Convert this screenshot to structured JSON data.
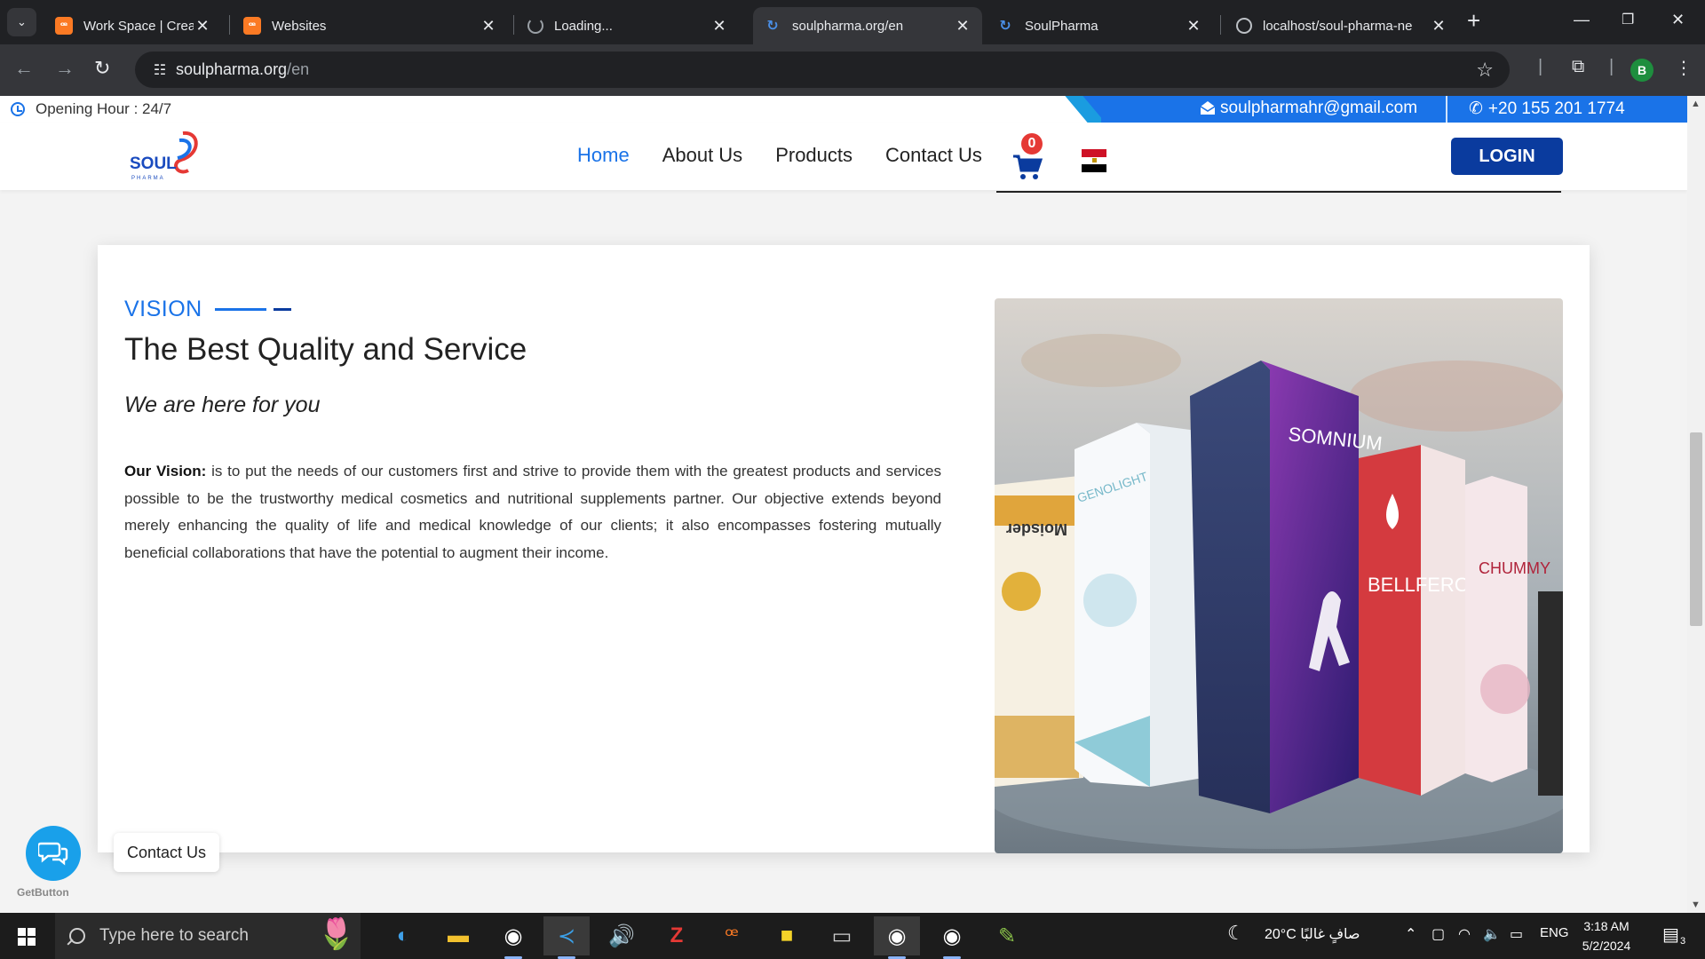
{
  "browser": {
    "tabs": [
      {
        "title": "Work Space | Created By E",
        "icon": "xampp-icon",
        "active": false
      },
      {
        "title": "Websites",
        "icon": "xampp-icon",
        "active": false
      },
      {
        "title": "Loading...",
        "icon": "spinner-icon",
        "active": false
      },
      {
        "title": "soulpharma.org/en",
        "icon": "soulpharma-favicon",
        "active": true
      },
      {
        "title": "SoulPharma",
        "icon": "soulpharma-favicon",
        "active": false
      },
      {
        "title": "localhost/soul-pharma-ne",
        "icon": "globe-icon",
        "active": false
      }
    ],
    "address": {
      "host": "soulpharma.org",
      "path": "/en"
    },
    "profile_initial": "B"
  },
  "site": {
    "topbar": {
      "opening_hours": "Opening Hour : 24/7",
      "email": "soulpharmahr@gmail.com",
      "phone": "+20 155 201 1774"
    },
    "nav": {
      "logo_text": "SOUL",
      "logo_sub": "PHARMA",
      "items": [
        "Home",
        "About Us",
        "Products",
        "Contact Us"
      ],
      "active_item": "Home",
      "cart_count": "0",
      "login_label": "LOGIN"
    },
    "vision": {
      "label": "VISION",
      "headline": "The Best Quality and Service",
      "tagline": "We are here for you",
      "body_lead": "Our Vision:",
      "body": " is to put the needs of our customers first and strive to provide them with the greatest products and services possible to be the trustworthy medical cosmetics and nutritional supplements partner. Our objective extends beyond merely enhancing the quality of life and medical knowledge of our clients; it also encompasses fostering mutually beneficial collaborations that have the potential to augment their income."
    },
    "product_boxes": [
      "Moisder",
      "GENOLIGHT",
      "SOMNIUM",
      "BELLFERO",
      "CHUMMY"
    ],
    "widget": {
      "tooltip": "Contact Us",
      "brand": "GetButton"
    }
  },
  "taskbar": {
    "search_placeholder": "Type here to search",
    "weather": "20°C  صافٍ غالبًا",
    "language": "ENG",
    "time": "3:18 AM",
    "date": "5/2/2024",
    "notifications": "3"
  },
  "colors": {
    "accent": "#1a73e8",
    "login_bg": "#0a3b9e",
    "cart_badge": "#e53935"
  }
}
